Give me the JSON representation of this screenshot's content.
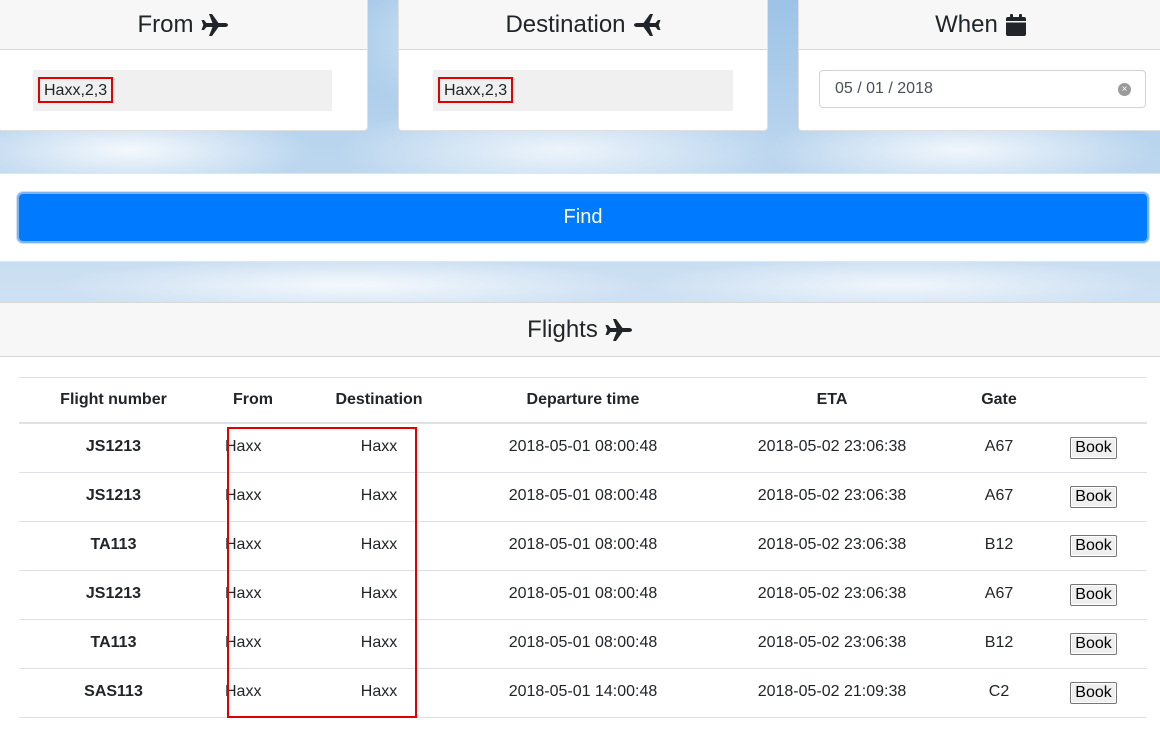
{
  "search": {
    "from": {
      "title": "From",
      "icon": "airplane-icon",
      "value": "Haxx,2,3"
    },
    "destination": {
      "title": "Destination",
      "icon": "airplane-landing-icon",
      "value": "Haxx,2,3"
    },
    "when": {
      "title": "When",
      "icon": "calendar-icon",
      "value": "05 / 01 / 2018"
    },
    "find_label": "Find"
  },
  "flights": {
    "title": "Flights",
    "icon": "airplane-icon",
    "columns": [
      "Flight number",
      "From",
      "Destination",
      "Departure time",
      "ETA",
      "Gate",
      ""
    ],
    "rows": [
      {
        "number": "JS1213",
        "from": "Haxx",
        "destination": "Haxx",
        "departure": "2018-05-01 08:00:48",
        "eta": "2018-05-02 23:06:38",
        "gate": "A67",
        "action": "Book"
      },
      {
        "number": "JS1213",
        "from": "Haxx",
        "destination": "Haxx",
        "departure": "2018-05-01 08:00:48",
        "eta": "2018-05-02 23:06:38",
        "gate": "A67",
        "action": "Book"
      },
      {
        "number": "TA113",
        "from": "Haxx",
        "destination": "Haxx",
        "departure": "2018-05-01 08:00:48",
        "eta": "2018-05-02 23:06:38",
        "gate": "B12",
        "action": "Book"
      },
      {
        "number": "JS1213",
        "from": "Haxx",
        "destination": "Haxx",
        "departure": "2018-05-01 08:00:48",
        "eta": "2018-05-02 23:06:38",
        "gate": "A67",
        "action": "Book"
      },
      {
        "number": "TA113",
        "from": "Haxx",
        "destination": "Haxx",
        "departure": "2018-05-01 08:00:48",
        "eta": "2018-05-02 23:06:38",
        "gate": "B12",
        "action": "Book"
      },
      {
        "number": "SAS113",
        "from": "Haxx",
        "destination": "Haxx",
        "departure": "2018-05-01 14:00:48",
        "eta": "2018-05-02 21:09:38",
        "gate": "C2",
        "action": "Book"
      }
    ]
  },
  "colors": {
    "primary": "#007bff",
    "highlight": "#e00000",
    "header_bg": "#f7f7f7"
  }
}
